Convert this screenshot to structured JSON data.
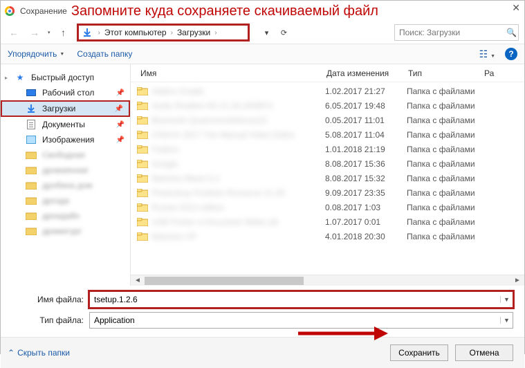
{
  "titlebar": {
    "title": "Сохранение",
    "hint": "Запомните куда сохраняете скачиваемый файл",
    "close": "✕"
  },
  "nav": {
    "back": "←",
    "fwd": "→",
    "up": "↑",
    "crumb1": "Этот компьютер",
    "crumb2": "Загрузки",
    "chev": "›",
    "dropdown": "▾",
    "refresh": "⟳",
    "search_placeholder": "Поиск: Загрузки"
  },
  "toolbar": {
    "organize": "Упорядочить",
    "newfolder": "Создать папку"
  },
  "sidebar": {
    "quick": "Быстрый доступ",
    "desktop": "Рабочий стол",
    "downloads": "Загрузки",
    "documents": "Документы",
    "images": "Изображения",
    "b1": "Свободная",
    "b2": "дроваянная",
    "b3": "дробина дом",
    "b4": "дрозда",
    "b5": "дроидайн",
    "b6": "драматург"
  },
  "columns": {
    "name": "Имя",
    "date": "Дата изменения",
    "type": "Тип",
    "size": "Ра"
  },
  "type_label": "Папка с файлами",
  "rows": [
    {
      "name": "Addins Gradle",
      "date": "1.02.2017 21:27"
    },
    {
      "name": "Audio Realtek HD 21.34.2009FG",
      "date": "6.05.2017 19:48"
    },
    {
      "name": "Bluetooth QualcommAtheros10",
      "date": "0.05.2017 11:01"
    },
    {
      "name": "CRACK 2017 The Manual Video Editor",
      "date": "5.08.2017 11:04"
    },
    {
      "name": "Folders",
      "date": "1.01.2018 21:19"
    },
    {
      "name": "Google",
      "date": "8.08.2017 15:36"
    },
    {
      "name": "Matches Black 5.2",
      "date": "8.08.2017 15:32"
    },
    {
      "name": "Photoshop Portfolio Romance 21.05",
      "date": "9.09.2017 23:35"
    },
    {
      "name": "Russia 2012 edition",
      "date": "0.08.2017 1:03"
    },
    {
      "name": "USB Printer a Document Writer p6",
      "date": "1.07.2017 0:01"
    },
    {
      "name": "Matches UP",
      "date": "4.01.2018 20:30"
    }
  ],
  "foot": {
    "filename_lbl": "Имя файла:",
    "filename_val": "tsetup.1.2.6",
    "filetype_lbl": "Тип файла:",
    "filetype_val": "Application"
  },
  "bottom": {
    "hide": "Скрыть папки",
    "save": "Сохранить",
    "cancel": "Отмена"
  }
}
